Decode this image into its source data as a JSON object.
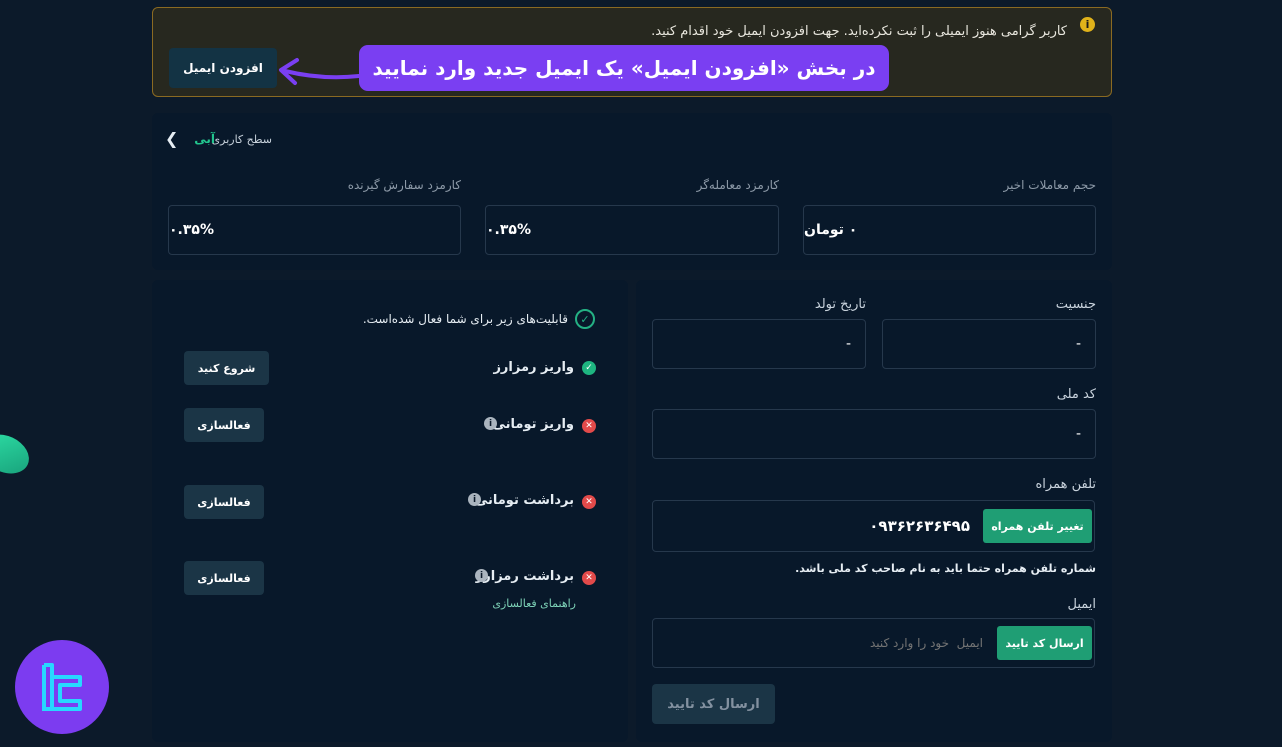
{
  "alert": {
    "message": "کاربر گرامی هنوز ایمیلی را ثبت نکرده‌اید. جهت افزودن ایمیل خود اقدام کنید.",
    "add_email_button": "افزودن ایمیل",
    "callout": "در بخش «افزودن ایمیل» یک ایمیل جدید وارد نمایید",
    "icon": "info-icon"
  },
  "level": {
    "label": "سطح کاربری",
    "value": "آبی"
  },
  "stats": [
    {
      "label": "حجم معاملات اخیر",
      "value": "۰ تومان"
    },
    {
      "label": "کارمزد معامله‌گر",
      "value": "۰.۳۵%"
    },
    {
      "label": "کارمزد سفارش گیرنده",
      "value": "۰.۳۵%"
    }
  ],
  "features": {
    "title": "قابلیت‌های زیر برای شما فعال شده‌است.",
    "items": [
      {
        "label": "واریز رمزارز",
        "status": "enabled",
        "button": "شروع کنید"
      },
      {
        "label": "واریز تومانی",
        "status": "disabled",
        "button": "فعالسازی"
      },
      {
        "label": "برداشت تومانی",
        "status": "disabled",
        "button": "فعالسازی"
      },
      {
        "label": "برداشت رمزارز",
        "status": "disabled",
        "button": "فعالسازی",
        "link": "راهنمای فعالسازی"
      }
    ]
  },
  "profile": {
    "gender_label": "جنسیت",
    "gender_value": "-",
    "birth_label": "تاریخ تولد",
    "birth_value": "-",
    "national_id_label": "کد ملی",
    "national_id_value": "-",
    "phone_label": "تلفن همراه",
    "phone_value": "۰۹۳۶۲۶۳۶۴۹۵",
    "change_phone_button": "تغییر تلفن همراه",
    "phone_note": "شماره تلفن همراه حتما باید به نام صاحب کد ملی باشد.",
    "email_label": "ایمیل",
    "email_placeholder": "ایمیل  خود را وارد کنید",
    "send_code_button": "ارسال کد تایید",
    "submit_button": "ارسال کد تایید"
  },
  "colors": {
    "background": "#0c1a2a",
    "card": "#08182a",
    "accent_green": "#1f9e74",
    "accent_purple": "#7a3ff2",
    "alert_border": "#8a6a22"
  }
}
